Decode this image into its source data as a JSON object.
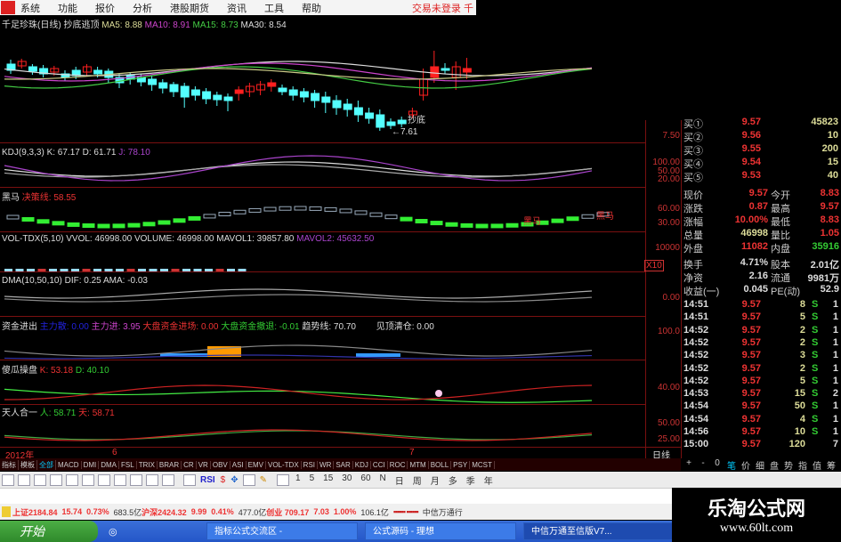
{
  "menu": {
    "items": [
      "系统",
      "功能",
      "报价",
      "分析",
      "港股期货",
      "资讯",
      "工具",
      "帮助"
    ],
    "login": "交易未登录 千"
  },
  "main": {
    "title": "千足珍珠(日线) 抄底逃顶",
    "ma5": "MA5: 8.88",
    "ma10": "MA10: 8.91",
    "ma15": "MA15: 8.73",
    "ma30": "MA30: 8.54",
    "ann_buy": "抄底",
    "ann_low": "←7.61",
    "axis": "7.50"
  },
  "kdj": {
    "name": "KDJ(9,3,3)",
    "k": "K: 67.17",
    "d": "D: 61.71",
    "j": "J: 78.10",
    "axis": [
      "100.00",
      "50.00",
      "20.00"
    ]
  },
  "heima": {
    "name": "黑马",
    "val": "决策线: 58.55",
    "axis": [
      "60.00",
      "30.00"
    ],
    "tag": "黑马"
  },
  "vol": {
    "name": "VOL-TDX(5,10)",
    "vvol": "VVOL: 46998.00",
    "volume": "VOLUME: 46998.00",
    "mavol1": "MAVOL1: 39857.80",
    "mavol2": "MAVOL2: 45632.50",
    "axis": "10000",
    "x10": "X10"
  },
  "dma": {
    "name": "DMA(10,50,10)",
    "dif": "DIF: 0.25",
    "ama": "AMA: -0.03",
    "axis": "0.00"
  },
  "zj": {
    "name": "资金进出",
    "a": "主力散: 0.00",
    "b": "主力进: 3.95",
    "c": "大盘资金进场: 0.00",
    "d": "大盘资金撤退: -0.01",
    "e": "趋势线: 70.70",
    "f": "见顶清仓: 0.00",
    "axis": "100.0"
  },
  "sg": {
    "name": "傻瓜操盘",
    "k": "K: 53.18",
    "d": "D: 40.10",
    "axis": "40.00"
  },
  "tr": {
    "name": "天人合一",
    "ren": "人: 58.71",
    "tian": "天: 58.71",
    "axis": [
      "50.00",
      "25.00"
    ]
  },
  "dates": {
    "year": "2012年",
    "m6": "6",
    "m7": "7",
    "period": "日线"
  },
  "quote": {
    "bids": [
      {
        "k": "买①",
        "p": "9.57",
        "v": "45823"
      },
      {
        "k": "买②",
        "p": "9.56",
        "v": "10"
      },
      {
        "k": "买③",
        "p": "9.55",
        "v": "200"
      },
      {
        "k": "买④",
        "p": "9.54",
        "v": "15"
      },
      {
        "k": "买⑤",
        "p": "9.53",
        "v": "40"
      }
    ],
    "stats": [
      [
        "现价",
        "9.57",
        "今开",
        "8.83"
      ],
      [
        "涨跌",
        "0.87",
        "最高",
        "9.57"
      ],
      [
        "涨幅",
        "10.00%",
        "最低",
        "8.83"
      ],
      [
        "总量",
        "46998",
        "量比",
        "1.05"
      ],
      [
        "外盘",
        "11082",
        "内盘",
        "35916"
      ],
      [
        "换手",
        "4.71%",
        "股本",
        "2.01亿"
      ],
      [
        "净资",
        "2.16",
        "流通",
        "9981万"
      ],
      [
        "收益(一)",
        "0.045",
        "PE(动)",
        "52.9"
      ]
    ],
    "ticks": [
      [
        "14:51",
        "9.57",
        "8",
        "S",
        "1"
      ],
      [
        "14:51",
        "9.57",
        "5",
        "S",
        "1"
      ],
      [
        "14:52",
        "9.57",
        "2",
        "S",
        "1"
      ],
      [
        "14:52",
        "9.57",
        "2",
        "S",
        "1"
      ],
      [
        "14:52",
        "9.57",
        "3",
        "S",
        "1"
      ],
      [
        "14:52",
        "9.57",
        "2",
        "S",
        "1"
      ],
      [
        "14:52",
        "9.57",
        "5",
        "S",
        "1"
      ],
      [
        "14:53",
        "9.57",
        "15",
        "S",
        "2"
      ],
      [
        "14:54",
        "9.57",
        "50",
        "S",
        "1"
      ],
      [
        "14:54",
        "9.57",
        "4",
        "S",
        "1"
      ],
      [
        "14:56",
        "9.57",
        "10",
        "S",
        "1"
      ],
      [
        "15:00",
        "9.57",
        "120",
        "",
        "7"
      ]
    ]
  },
  "tabs": [
    "指标",
    "模板",
    "全部",
    "MACD",
    "DMI",
    "DMA",
    "FSL",
    "TRIX",
    "BRAR",
    "CR",
    "VR",
    "OBV",
    "ASI",
    "EMV",
    "VOL-TDX",
    "RSI",
    "WR",
    "SAR",
    "KDJ",
    "CCI",
    "ROC",
    "MTM",
    "BOLL",
    "PSY",
    "MCST"
  ],
  "right_tabs": [
    "+",
    "-",
    "0",
    "笔",
    "价",
    "细",
    "盘",
    "势",
    "指",
    "值",
    "筹"
  ],
  "toolbar": {
    "periods": [
      "1",
      "5",
      "15",
      "30",
      "60",
      "N",
      "日",
      "周",
      "月",
      "多",
      "季",
      "年"
    ],
    "rsi": "RSI"
  },
  "status": {
    "sh": "上证2184.84",
    "sh_chg": "15.74",
    "sh_pct": "0.73%",
    "sh_amt": "683.5亿",
    "sz": "沪深2424.32",
    "sz_chg": "9.99",
    "sz_pct": "0.41%",
    "sz_amt": "477.0亿",
    "cy": "创业 709.17",
    "cy_chg": "7.03",
    "cy_pct": "1.00%",
    "cy_amt": "106.1亿",
    "broker": "中信万通行"
  },
  "taskbar": {
    "start": "开始",
    "tasks": [
      "指标公式交流区 -",
      "公式源码 - 理想",
      "中信万通至信版V7..."
    ]
  },
  "watermark": {
    "line1": "乐淘公式网",
    "line2": "www.60lt.com"
  },
  "colors": {
    "up": "#ff2020",
    "down": "#54ffff",
    "ma5": "#dddddd",
    "ma10": "#cc44cc",
    "ma15": "#44cc44",
    "ma30": "#cccc88"
  }
}
